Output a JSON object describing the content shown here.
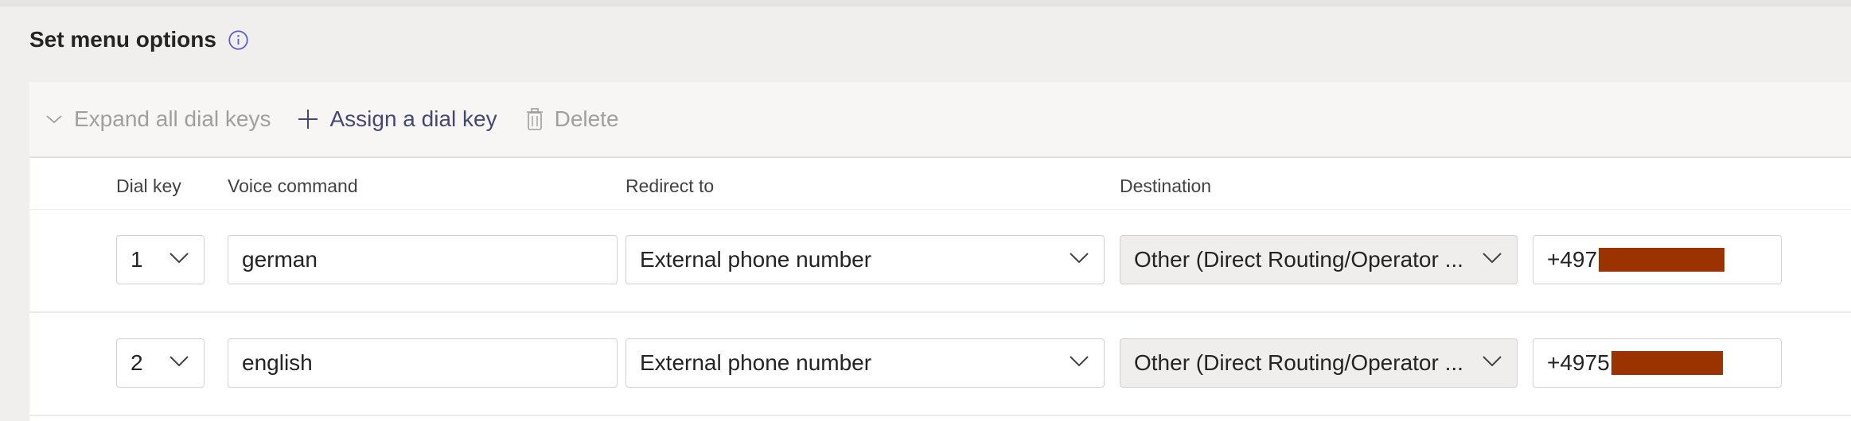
{
  "section": {
    "title": "Set menu options"
  },
  "toolbar": {
    "expand_label": "Expand all dial keys",
    "assign_label": "Assign a dial key",
    "delete_label": "Delete"
  },
  "columns": {
    "dial_key": "Dial key",
    "voice_command": "Voice command",
    "redirect_to": "Redirect to",
    "destination": "Destination"
  },
  "rows": [
    {
      "dial_key": "1",
      "voice_command": "german",
      "redirect_to": "External phone number",
      "destination": "Other (Direct Routing/Operator ...",
      "phone_visible": "+497"
    },
    {
      "dial_key": "2",
      "voice_command": "english",
      "redirect_to": "External phone number",
      "destination": "Other (Direct Routing/Operator ...",
      "phone_visible": "+4975"
    }
  ],
  "colors": {
    "accent": "#464775",
    "disabled": "#a19f9d",
    "redaction": "#9b3300"
  },
  "icons": {
    "info": "info-icon",
    "expand": "chevron-down-icon",
    "assign": "plus-icon",
    "delete": "trash-icon",
    "dropdown": "chevron-down-icon"
  }
}
